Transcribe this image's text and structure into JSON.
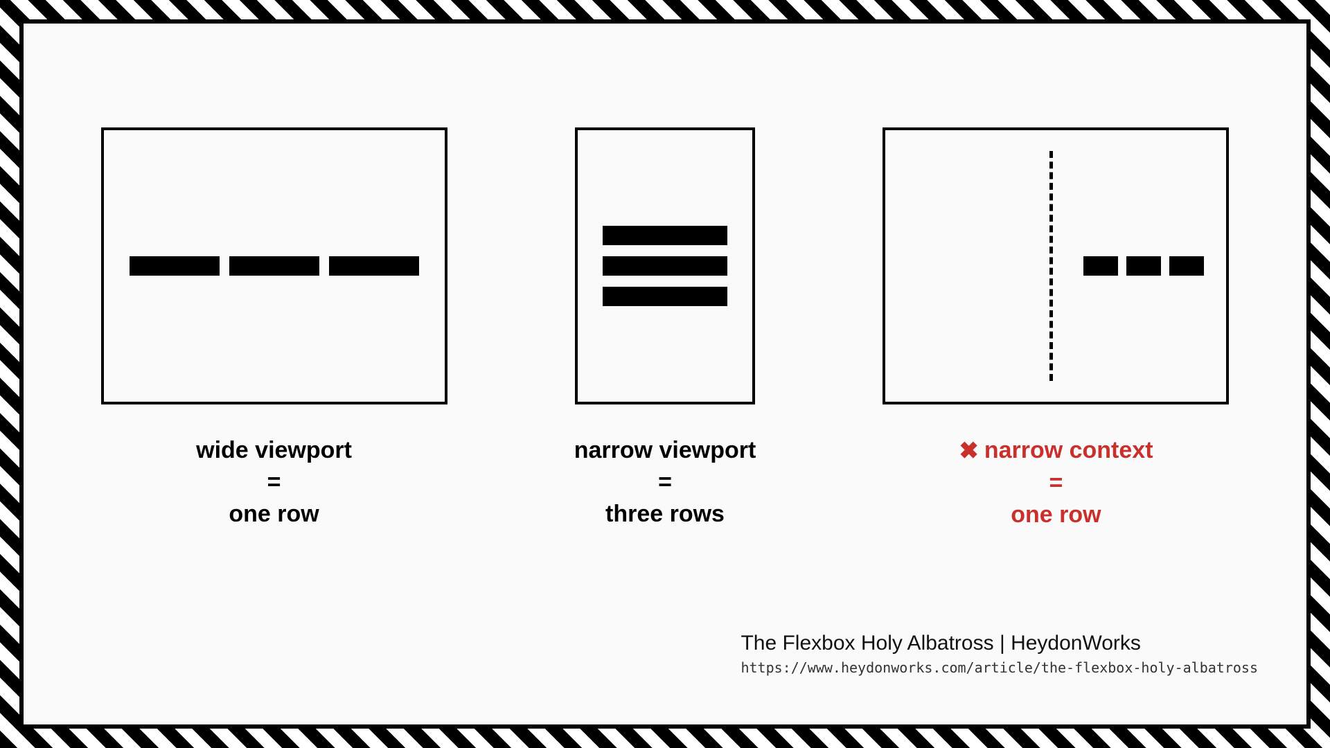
{
  "diagrams": {
    "wide": {
      "line1": "wide viewport",
      "eq": "=",
      "line2": "one row"
    },
    "narrow": {
      "line1": "narrow viewport",
      "eq": "=",
      "line2": "three rows"
    },
    "context": {
      "icon": "✖",
      "line1": "narrow context",
      "eq": "=",
      "line2": "one row"
    }
  },
  "credit": {
    "title": "The Flexbox Holy Albatross | HeydonWorks",
    "url": "https://www.heydonworks.com/article/the-flexbox-holy-albatross"
  },
  "colors": {
    "error": "#c9302c",
    "ink": "#000000",
    "bg": "#fafafa"
  }
}
